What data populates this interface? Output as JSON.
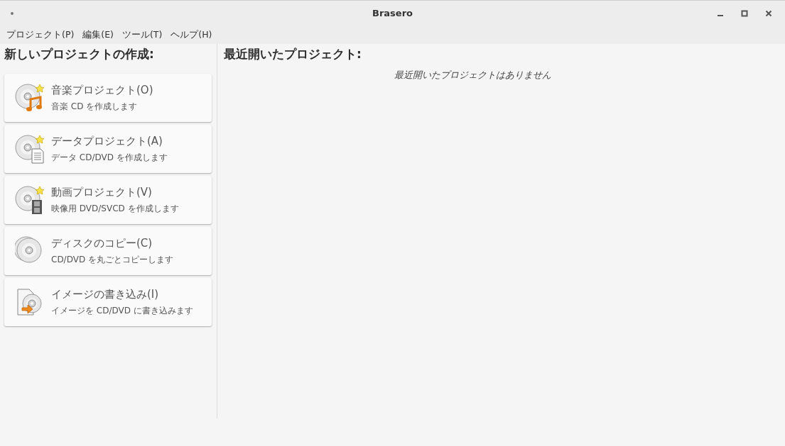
{
  "window": {
    "title": "Brasero"
  },
  "menu": [
    "プロジェクト(P)",
    "編集(E)",
    "ツール(T)",
    "ヘルプ(H)"
  ],
  "new_project": {
    "heading": "新しいプロジェクトの作成:",
    "items": [
      {
        "kind": "audio",
        "title": "音楽プロジェクト(O)",
        "description": "音楽 CD を作成します"
      },
      {
        "kind": "data",
        "title": "データプロジェクト(A)",
        "description": "データ CD/DVD を作成します"
      },
      {
        "kind": "video",
        "title": "動画プロジェクト(V)",
        "description": "映像用 DVD/SVCD を作成します"
      },
      {
        "kind": "copy",
        "title": "ディスクのコピー(C)",
        "description": "CD/DVD を丸ごとコピーします"
      },
      {
        "kind": "image",
        "title": "イメージの書き込み(I)",
        "description": "イメージを CD/DVD に書き込みます"
      }
    ]
  },
  "recent": {
    "heading": "最近開いたプロジェクト:",
    "empty_message": "最近開いたプロジェクトはありません"
  }
}
